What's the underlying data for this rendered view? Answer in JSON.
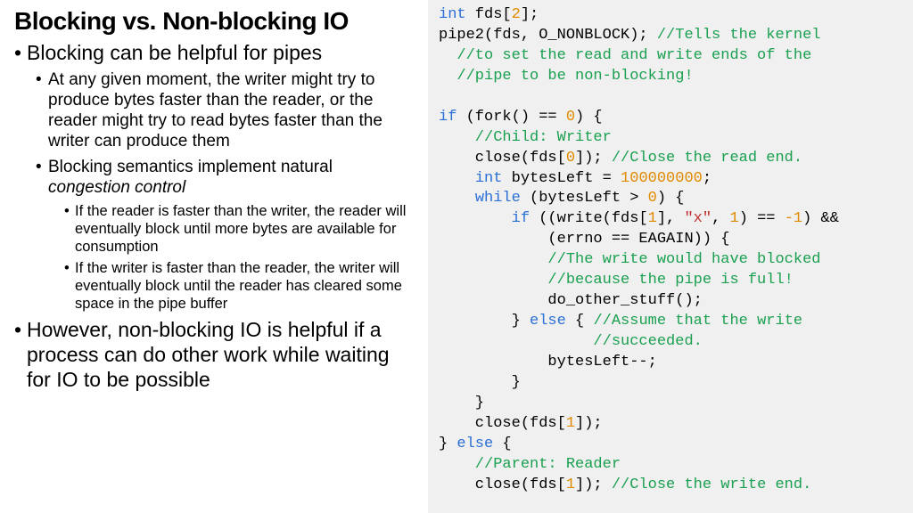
{
  "title": "Blocking vs. Non-blocking IO",
  "bullets": {
    "b1": "Blocking can be helpful for pipes",
    "b1_1": "At any given moment, the writer might try to produce bytes faster than the reader, or the reader might try to read bytes faster than the writer can produce them",
    "b1_2a": "Blocking semantics implement natural ",
    "b1_2b": "congestion control",
    "b1_2_1": "If the reader is faster than the writer, the reader will eventually block until more bytes are available for consumption",
    "b1_2_2": "If the writer is faster than the reader, the writer will eventually block until the reader has cleared some space in the pipe buffer",
    "b2": "However, non-blocking IO is helpful if a process can do other work while waiting for IO to be possible"
  },
  "code": {
    "l1a": "int",
    "l1b": " fds[",
    "l1c": "2",
    "l1d": "];",
    "l2a": "pipe2(fds, O_NONBLOCK); ",
    "l2b": "//Tells the kernel",
    "l3": "  //to set the read and write ends of the",
    "l4": "  //pipe to be non-blocking!",
    "l5": "",
    "l6a": "if",
    "l6b": " (fork() == ",
    "l6c": "0",
    "l6d": ") {",
    "l7": "    //Child: Writer",
    "l8a": "    close(fds[",
    "l8b": "0",
    "l8c": "]); ",
    "l8d": "//Close the read end.",
    "l9a": "    ",
    "l9b": "int",
    "l9c": " bytesLeft = ",
    "l9d": "100000000",
    "l9e": ";",
    "l10a": "    ",
    "l10b": "while",
    "l10c": " (bytesLeft > ",
    "l10d": "0",
    "l10e": ") {",
    "l11a": "        ",
    "l11b": "if",
    "l11c": " ((write(fds[",
    "l11d": "1",
    "l11e": "], ",
    "l11f": "\"x\"",
    "l11g": ", ",
    "l11h": "1",
    "l11i": ") == ",
    "l11j": "-1",
    "l11k": ") &&",
    "l12": "            (errno == EAGAIN)) {",
    "l13": "            //The write would have blocked",
    "l14": "            //because the pipe is full!",
    "l15": "            do_other_stuff();",
    "l16a": "        } ",
    "l16b": "else",
    "l16c": " { ",
    "l16d": "//Assume that the write",
    "l17": "                 //succeeded.",
    "l18": "            bytesLeft--;",
    "l19": "        }",
    "l20": "    }",
    "l21a": "    close(fds[",
    "l21b": "1",
    "l21c": "]);",
    "l22a": "} ",
    "l22b": "else",
    "l22c": " {",
    "l23": "    //Parent: Reader",
    "l24a": "    close(fds[",
    "l24b": "1",
    "l24c": "]); ",
    "l24d": "//Close the write end."
  }
}
